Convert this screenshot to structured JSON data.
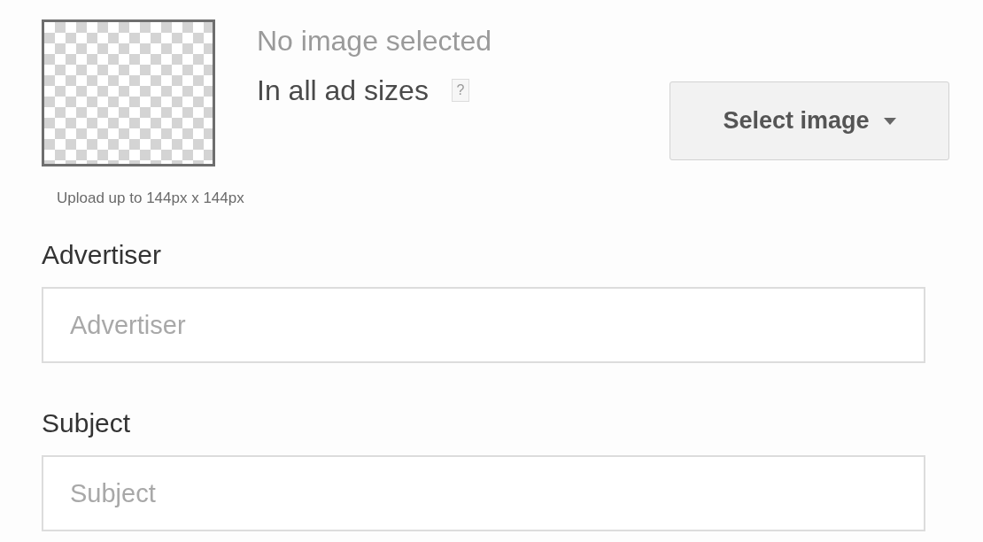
{
  "image": {
    "status": "No image selected",
    "scope": "In all ad sizes",
    "help": "?",
    "upload_hint": "Upload up to 144px x 144px"
  },
  "select_button": {
    "label": "Select image"
  },
  "fields": [
    {
      "label": "Advertiser",
      "placeholder": "Advertiser"
    },
    {
      "label": "Subject",
      "placeholder": "Subject"
    }
  ]
}
